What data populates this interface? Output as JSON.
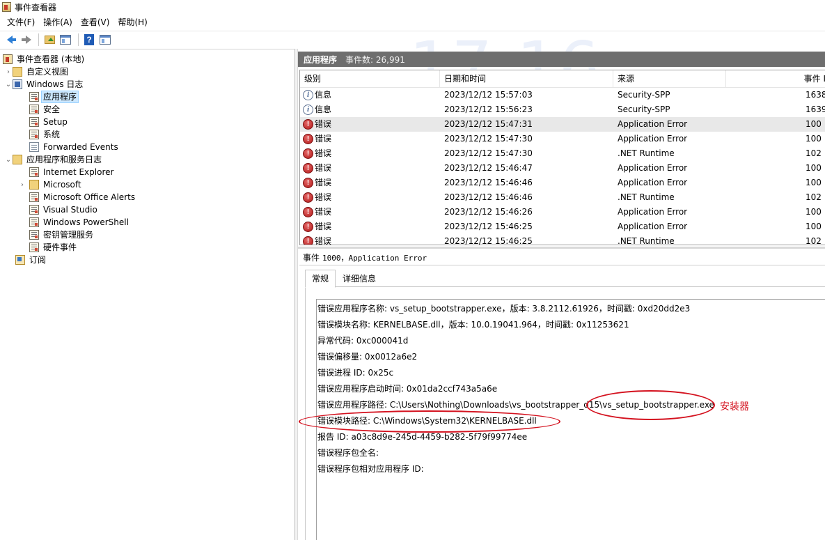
{
  "window": {
    "title": "事件查看器"
  },
  "menu": [
    "文件(F)",
    "操作(A)",
    "查看(V)",
    "帮助(H)"
  ],
  "tree": {
    "root": "事件查看器 (本地)",
    "custom_views": "自定义视图",
    "windows_logs": "Windows 日志",
    "windows_logs_items": [
      "应用程序",
      "安全",
      "Setup",
      "系统",
      "Forwarded Events"
    ],
    "app_service_logs": "应用程序和服务日志",
    "app_service_items": [
      "Internet Explorer",
      "Microsoft",
      "Microsoft Office Alerts",
      "Visual Studio",
      "Windows PowerShell",
      "密钥管理服务",
      "硬件事件"
    ],
    "subscriptions": "订阅"
  },
  "header": {
    "title": "应用程序",
    "count": "事件数: 26,991"
  },
  "watermark": "17:16",
  "table": {
    "columns": [
      "级别",
      "日期和时间",
      "来源",
      "事件 I"
    ],
    "rows": [
      {
        "level": "信息",
        "type": "info",
        "date": "2023/12/12 15:57:03",
        "source": "Security-SPP",
        "event": "1638"
      },
      {
        "level": "信息",
        "type": "info",
        "date": "2023/12/12 15:56:23",
        "source": "Security-SPP",
        "event": "1639"
      },
      {
        "level": "错误",
        "type": "error",
        "date": "2023/12/12 15:47:31",
        "source": "Application Error",
        "event": "100"
      },
      {
        "level": "错误",
        "type": "error",
        "date": "2023/12/12 15:47:30",
        "source": "Application Error",
        "event": "100"
      },
      {
        "level": "错误",
        "type": "error",
        "date": "2023/12/12 15:47:30",
        "source": ".NET Runtime",
        "event": "102"
      },
      {
        "level": "错误",
        "type": "error",
        "date": "2023/12/12 15:46:47",
        "source": "Application Error",
        "event": "100"
      },
      {
        "level": "错误",
        "type": "error",
        "date": "2023/12/12 15:46:46",
        "source": "Application Error",
        "event": "100"
      },
      {
        "level": "错误",
        "type": "error",
        "date": "2023/12/12 15:46:46",
        "source": ".NET Runtime",
        "event": "102"
      },
      {
        "level": "错误",
        "type": "error",
        "date": "2023/12/12 15:46:26",
        "source": "Application Error",
        "event": "100"
      },
      {
        "level": "错误",
        "type": "error",
        "date": "2023/12/12 15:46:25",
        "source": "Application Error",
        "event": "100"
      },
      {
        "level": "错误",
        "type": "error",
        "date": "2023/12/12 15:46:25",
        "source": ".NET Runtime",
        "event": "102"
      }
    ]
  },
  "detail": {
    "title_prefix": "事件",
    "title_rest": "1000，Application Error",
    "tabs": [
      "常规",
      "详细信息"
    ],
    "lines": [
      "错误应用程序名称: vs_setup_bootstrapper.exe，版本: 3.8.2112.61926，时间戳: 0xd20dd2e3",
      "错误模块名称: KERNELBASE.dll，版本: 10.0.19041.964，时间戳: 0x11253621",
      "异常代码: 0xc000041d",
      "错误偏移量: 0x0012a6e2",
      "错误进程 ID: 0x25c",
      "错误应用程序启动时间: 0x01da2ccf743a5a6e",
      "错误应用程序路径: C:\\Users\\Nothing\\Downloads\\vs_bootstrapper_d15\\vs_setup_bootstrapper.exe",
      "错误模块路径: C:\\Windows\\System32\\KERNELBASE.dll",
      "报告 ID: a03c8d9e-245d-4459-b282-5f79f99774ee",
      "错误程序包全名:",
      "错误程序包相对应用程序 ID:"
    ]
  },
  "annotation": {
    "label": "安装器",
    "color": "#d4121f"
  }
}
